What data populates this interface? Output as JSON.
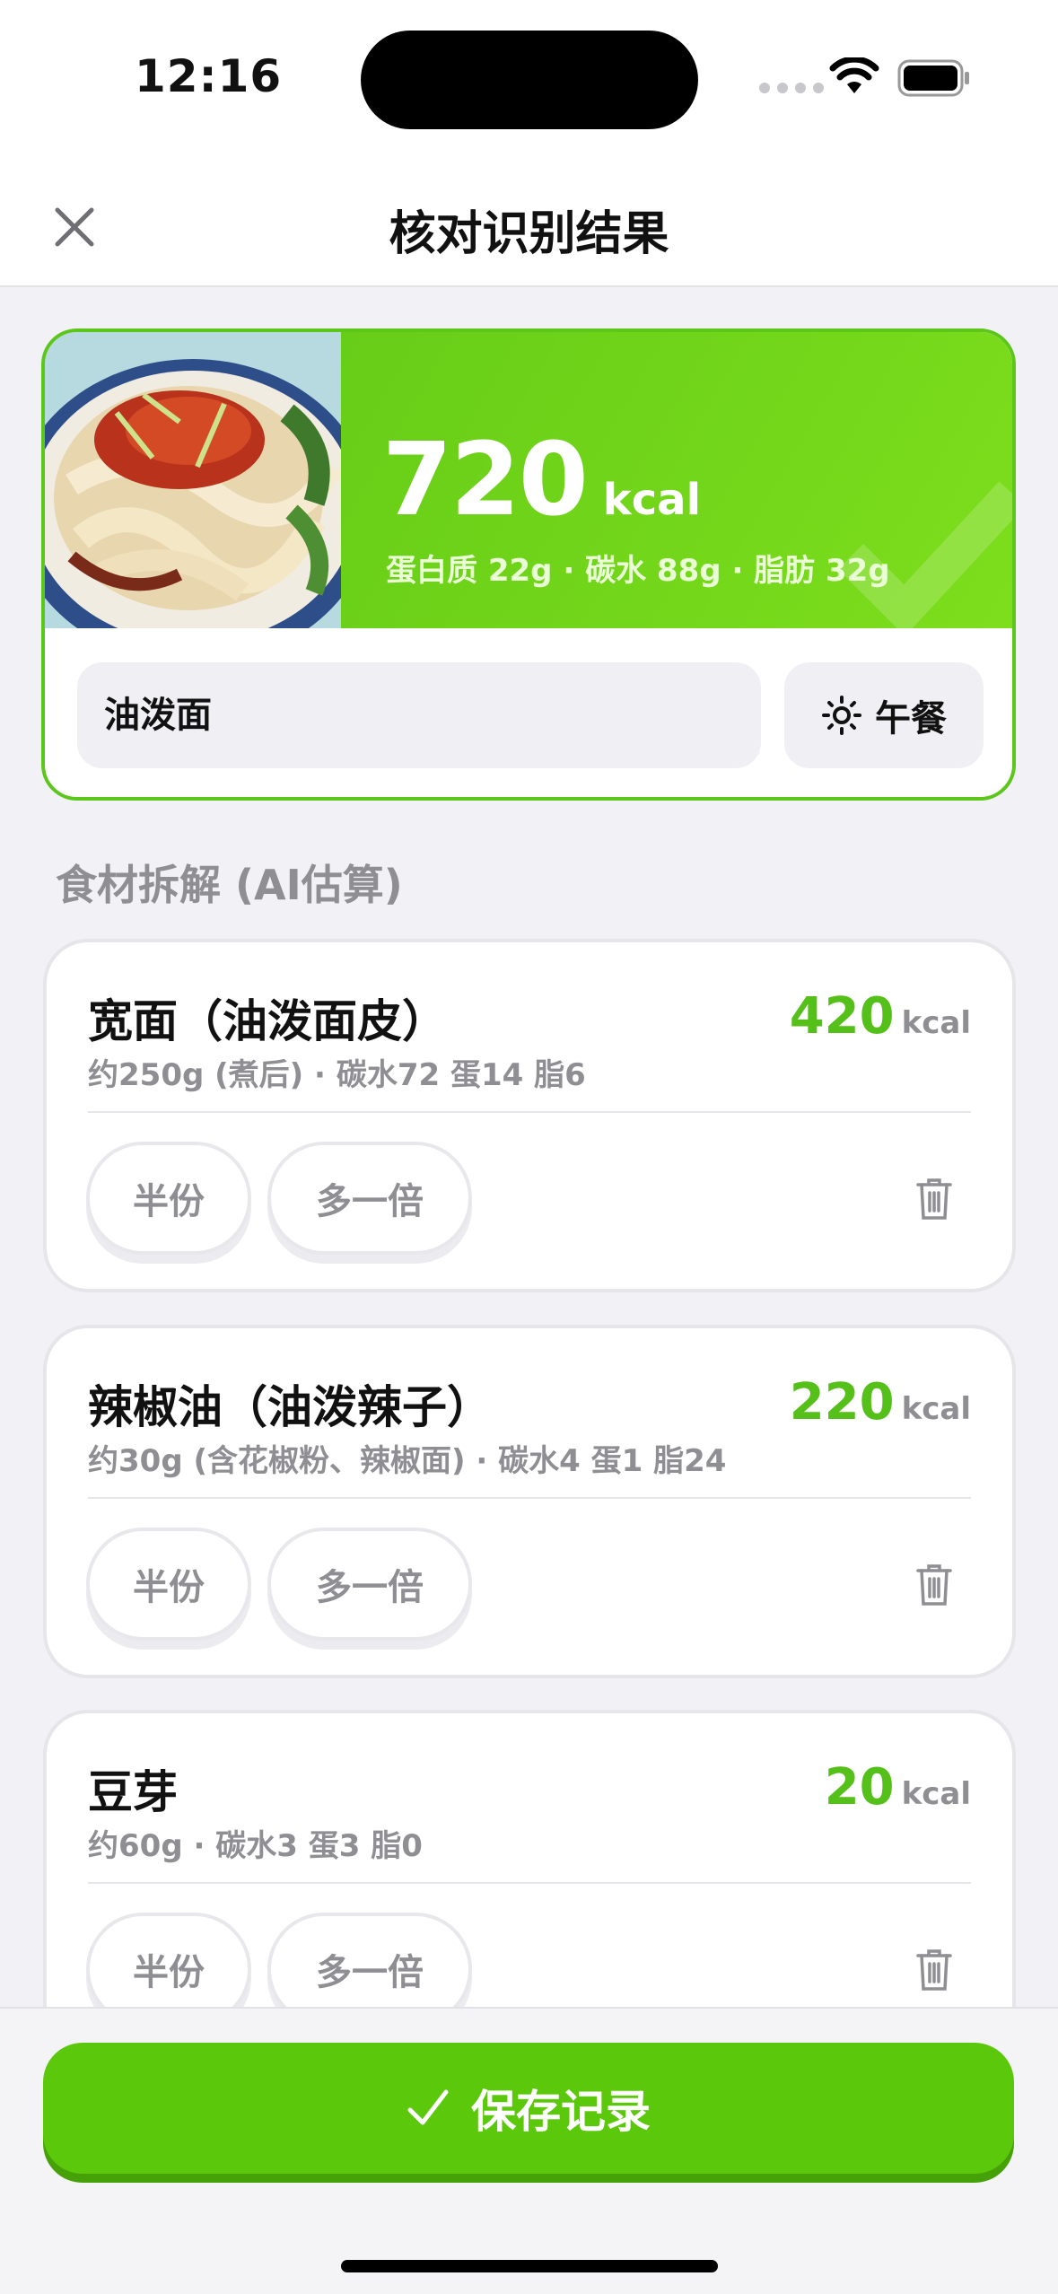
{
  "status_bar": {
    "time": "12:16"
  },
  "nav": {
    "title": "核对识别结果"
  },
  "summary": {
    "kcal": "720",
    "kcal_unit": "kcal",
    "macros": "蛋白质 22g · 碳水 88g · 脂肪 32g",
    "dish_name": "油泼面",
    "meal": "午餐",
    "meal_icon": "sun-icon"
  },
  "section_label": "食材拆解 (AI估算)",
  "ingredients": [
    {
      "name": "宽面（油泼面皮）",
      "detail": "约250g (煮后) · 碳水72 蛋14 脂6",
      "kcal": "420",
      "unit": "kcal",
      "half": "半份",
      "double": "多一倍"
    },
    {
      "name": "辣椒油（油泼辣子）",
      "detail": "约30g (含花椒粉、辣椒面) · 碳水4 蛋1 脂24",
      "kcal": "220",
      "unit": "kcal",
      "half": "半份",
      "double": "多一倍"
    },
    {
      "name": "豆芽",
      "detail": "约60g · 碳水3 蛋3 脂0",
      "kcal": "20",
      "unit": "kcal",
      "half": "半份",
      "double": "多一倍"
    }
  ],
  "save_button": "保存记录",
  "colors": {
    "accent": "#5cc80c",
    "kcal_green": "#55c01a",
    "muted": "#8e8e93"
  }
}
